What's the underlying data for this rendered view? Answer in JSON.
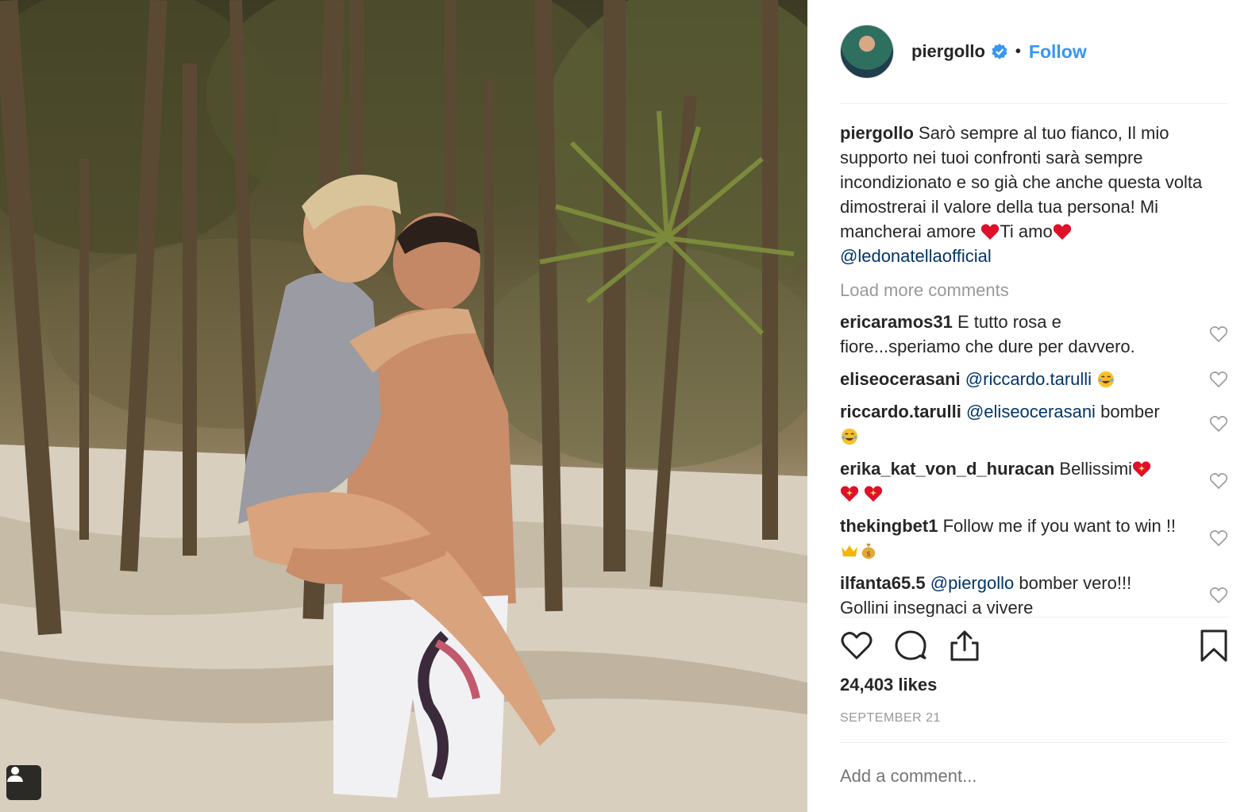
{
  "post": {
    "username": "piergollo",
    "follow_label": "Follow",
    "dot": "•",
    "caption": {
      "username": "piergollo",
      "text_1": "Sarò sempre al tuo fianco, Il mio supporto nei tuoi confronti sarà sempre incondizionato e so già che anche questa volta dimostrerai il valore della tua persona! Mi mancherai amore ",
      "text_2": "Ti amo",
      "mention": "@ledonatellaofficial"
    },
    "load_more": "Load more comments",
    "comments": [
      {
        "user": "ericaramos31",
        "text": "E tutto rosa e fiore...speriamo che dure per davvero."
      },
      {
        "user": "eliseocerasani",
        "mention": "@riccardo.tarulli",
        "text": ""
      },
      {
        "user": "riccardo.tarulli",
        "mention": "@eliseocerasani",
        "text": "bomber"
      },
      {
        "user": "erika_kat_von_d_huracan",
        "text": "Bellissimi"
      },
      {
        "user": "thekingbet1",
        "text": "Follow me if you want to win !!"
      },
      {
        "user": "ilfanta65.5",
        "mention": "@piergollo",
        "text": "bomber vero!!!",
        "text_2": "Gollini insegnaci a vivere"
      }
    ],
    "likes": "24,403 likes",
    "date": "SEPTEMBER 21",
    "add_comment_placeholder": "Add a comment..."
  },
  "colors": {
    "link_blue": "#3897f0",
    "mention_blue": "#003569",
    "muted_gray": "#999999",
    "text": "#262626"
  },
  "icons": {
    "verified": "verified-badge-icon",
    "like": "heart-icon",
    "comment": "comment-bubble-icon",
    "share": "share-icon",
    "save": "bookmark-icon",
    "tagged": "person-tag-icon"
  }
}
